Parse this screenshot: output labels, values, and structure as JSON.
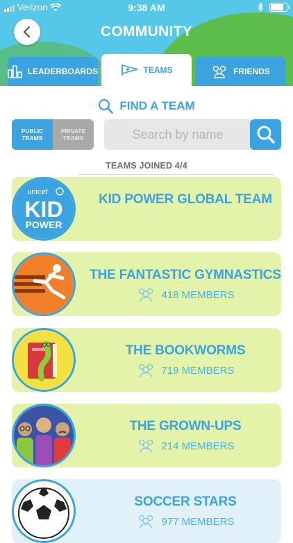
{
  "status_bar": {
    "carrier": "Verizon",
    "time": "9:38 AM"
  },
  "header": {
    "title": "COMMUNITY",
    "back_icon": "chevron-left-icon"
  },
  "tabs": [
    {
      "label": "LEADERBOARDS",
      "icon": "bar-chart-icon",
      "active": false
    },
    {
      "label": "TEAMS",
      "icon": "pennant-icon",
      "active": true
    },
    {
      "label": "FRIENDS",
      "icon": "people-icon",
      "active": false
    }
  ],
  "find_team": {
    "label": "FIND A TEAM",
    "icon": "search-icon"
  },
  "team_filter": {
    "public_label": "PUBLIC TEAMS",
    "private_label": "PRIVATE TEAMS",
    "selected": "PUBLIC TEAMS"
  },
  "search": {
    "placeholder": "Search by name",
    "value": ""
  },
  "teams_joined": "TEAMS JOINED 4/4",
  "kid_power_logo": {
    "brand": "unicef",
    "line1": "KID",
    "line2": "POWER"
  },
  "teams": [
    {
      "name": "KID POWER GLOBAL TEAM",
      "members": "",
      "avatar": "unicef-kid-power-logo"
    },
    {
      "name": "THE FANTASTIC GYMNASTICS",
      "members": "418 MEMBERS",
      "avatar": "gymnast-icon"
    },
    {
      "name": "THE BOOKWORMS",
      "members": "719 MEMBERS",
      "avatar": "bookworm-icon"
    },
    {
      "name": "THE GROWN-UPS",
      "members": "214 MEMBERS",
      "avatar": "grown-ups-icon"
    },
    {
      "name": "SOCCER STARS",
      "members": "977 MEMBERS",
      "avatar": "soccer-ball-icon"
    }
  ],
  "colors": {
    "accent": "#3aa3e0",
    "card_green": "#e3f3aa",
    "card_blue": "#e1f1fa",
    "sky": "#55c7e8",
    "hill": "#5cbd4a"
  }
}
